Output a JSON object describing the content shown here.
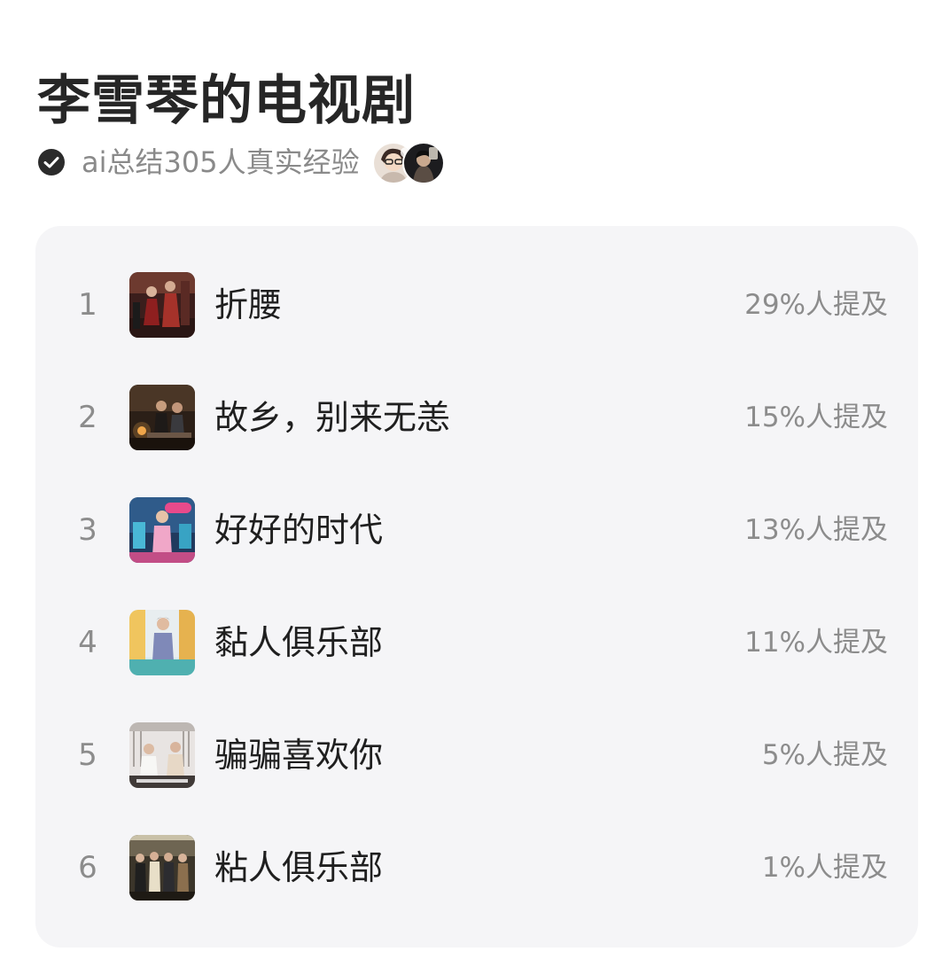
{
  "page": {
    "title": "李雪琴的电视剧"
  },
  "summary": {
    "text": "ai总结305人真实经验",
    "icon": "check-circle-icon",
    "avatars": [
      "user-avatar-1",
      "user-avatar-2"
    ]
  },
  "ranking": {
    "items": [
      {
        "rank": "1",
        "title": "折腰",
        "mention": "29%人提及",
        "thumb": "drama-still-red-costume"
      },
      {
        "rank": "2",
        "title": "故乡，别来无恙",
        "mention": "15%人提及",
        "thumb": "drama-still-dark-room"
      },
      {
        "rank": "3",
        "title": "好好的时代",
        "mention": "13%人提及",
        "thumb": "drama-still-pink-stage"
      },
      {
        "rank": "4",
        "title": "黏人俱乐部",
        "mention": "11%人提及",
        "thumb": "drama-still-teal-studio"
      },
      {
        "rank": "5",
        "title": "骗骗喜欢你",
        "mention": "5%人提及",
        "thumb": "drama-still-white-office"
      },
      {
        "rank": "6",
        "title": "粘人俱乐部",
        "mention": "1%人提及",
        "thumb": "drama-still-group-stage"
      }
    ]
  },
  "colors": {
    "title": "#262626",
    "secondary_text": "#8a8a8a",
    "card_background": "#f5f5f7",
    "check_icon": "#2b2b2b"
  }
}
